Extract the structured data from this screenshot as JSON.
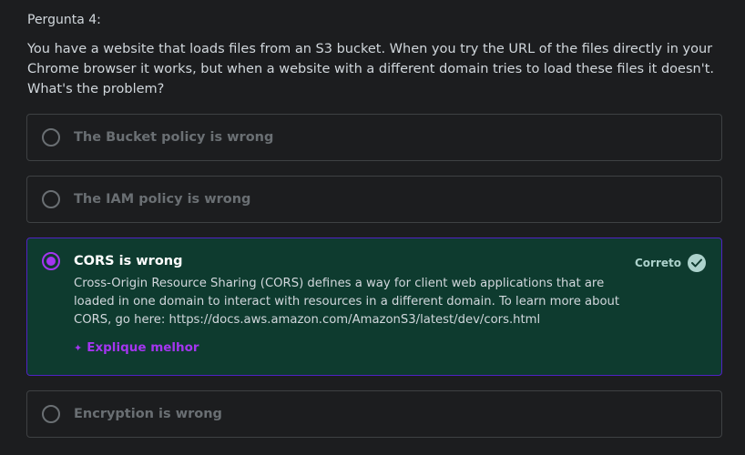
{
  "question": {
    "label": "Pergunta 4:",
    "text": "You have a website that loads files from an S3 bucket. When you try the URL of the files directly in your Chrome browser it works, but when a website with a different domain tries to load these files it doesn't. What's the problem?"
  },
  "options": [
    {
      "label": "The Bucket policy is wrong"
    },
    {
      "label": "The IAM policy is wrong"
    },
    {
      "label": "CORS is wrong",
      "explanation": "Cross-Origin Resource Sharing (CORS) defines a way for client web applications that are loaded in one domain to interact with resources in a different domain. To learn more about CORS, go here: https://docs.aws.amazon.com/AmazonS3/latest/dev/cors.html",
      "status": "Correto",
      "explain_link": "Explique melhor"
    },
    {
      "label": "Encryption is wrong"
    }
  ],
  "colors": {
    "correct_bg": "#0e3b2f",
    "accent_purple": "#a435f0",
    "correct_green": "#acd2cc"
  },
  "icons": {
    "check": "check-circle-icon",
    "sparkle": "sparkle-icon"
  }
}
